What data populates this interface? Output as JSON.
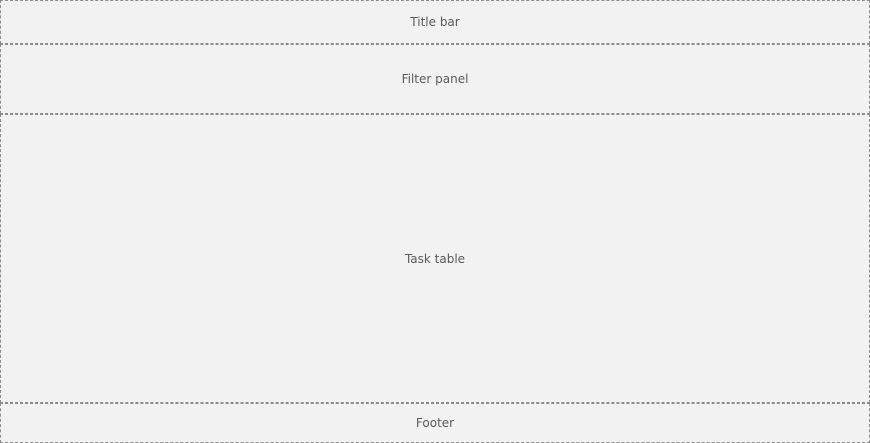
{
  "placeholder": {
    "title_bar": "Title bar",
    "filter_panel": "Filter panel",
    "task_table": "Task table",
    "footer": "Footer"
  }
}
